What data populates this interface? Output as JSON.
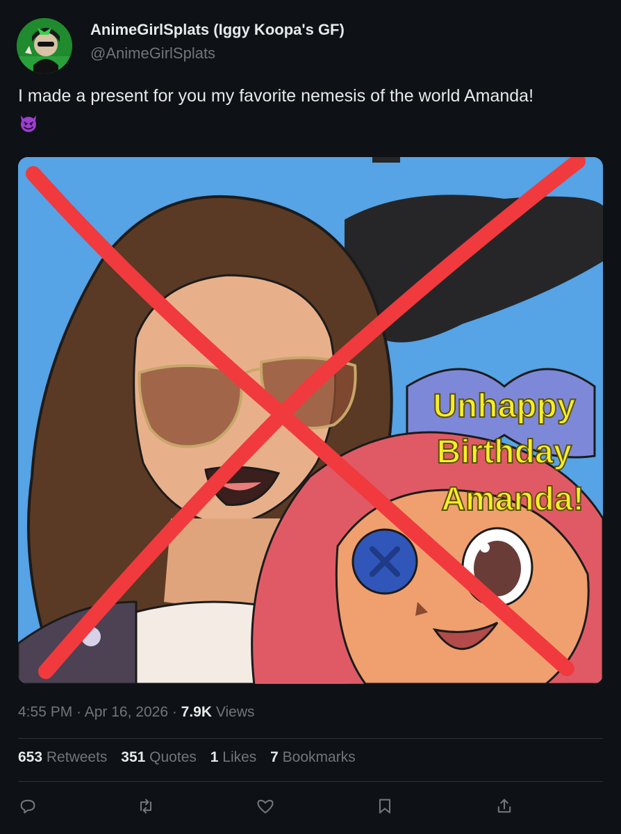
{
  "author": {
    "display_name": "AnimeGirlSplats (Iggy Koopa's GF)",
    "handle": "@AnimeGirlSplats"
  },
  "tweet": {
    "text": "I made a present for you my favorite nemesis of the world Amanda!",
    "emoji": "smiling-face-with-horns"
  },
  "media": {
    "caption_lines": [
      "Unhappy",
      "Birthday",
      "Amanda!"
    ]
  },
  "meta": {
    "time": "4:55 PM",
    "sep1": " · ",
    "date": "Apr 16, 2026",
    "sep2": " · ",
    "views_count": "7.9K",
    "views_label": "Views"
  },
  "stats": {
    "retweets_count": "653",
    "retweets_label": "Retweets",
    "quotes_count": "351",
    "quotes_label": "Quotes",
    "likes_count": "1",
    "likes_label": "Likes",
    "bookmarks_count": "7",
    "bookmarks_label": "Bookmarks"
  },
  "actions": [
    "reply-icon",
    "retweet-icon",
    "like-icon",
    "bookmark-icon",
    "share-icon"
  ],
  "colors": {
    "background": "#0e1115",
    "text_primary": "#e7e9ea",
    "text_secondary": "#71767b",
    "divider": "#2f3336",
    "x_mark": "#f03a3e",
    "caption_yellow": "#f6ee2a"
  }
}
